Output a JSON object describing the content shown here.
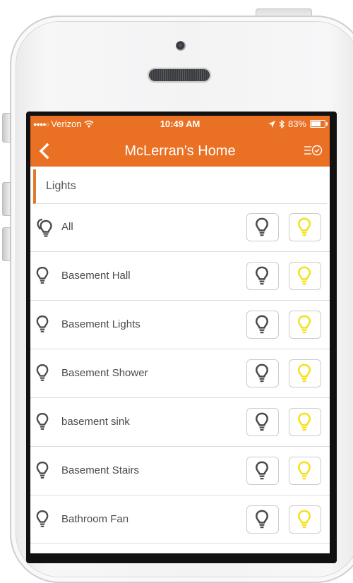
{
  "status_bar": {
    "carrier": "Verizon",
    "time": "10:49 AM",
    "battery": "83%",
    "battery_level": 0.83
  },
  "nav": {
    "title": "McLerran's Home"
  },
  "section": {
    "label": "Lights"
  },
  "lights": [
    {
      "label": "All"
    },
    {
      "label": "Basement Hall"
    },
    {
      "label": "Basement Lights"
    },
    {
      "label": "Basement Shower"
    },
    {
      "label": "basement sink"
    },
    {
      "label": "Basement Stairs"
    },
    {
      "label": "Bathroom Fan"
    }
  ],
  "colors": {
    "header": "#ea7024",
    "accent": "#e07a2a",
    "bulb_on": "#f2e21a",
    "bulb_off": "#4a4a4a"
  },
  "icons": {
    "back": "chevron-left-icon",
    "schedule": "schedule-list-icon",
    "off": "bulb-off-icon",
    "on": "bulb-on-icon"
  }
}
